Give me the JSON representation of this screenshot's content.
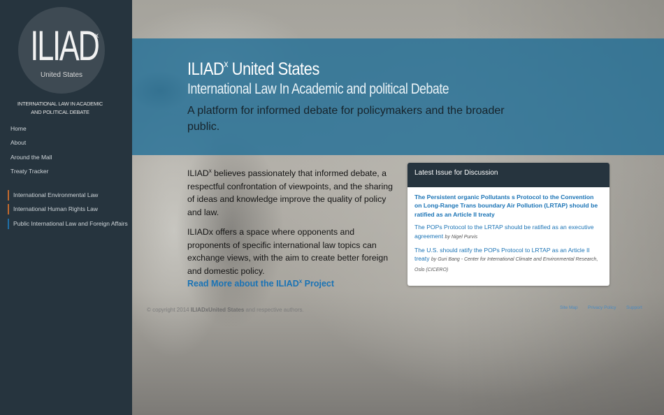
{
  "sidebar": {
    "logo": {
      "main": "ILIAD",
      "sup": "x",
      "sub": "United States"
    },
    "tagline": "INTERNATIONAL LAW IN ACADEMIC AND POLITICAL DEBATE",
    "nav": [
      "Home",
      "About",
      "Around the Mall",
      "Treaty Tracker"
    ],
    "topics": [
      {
        "label": "International Environmental Law",
        "color": "#c26a2d"
      },
      {
        "label": "International Human Rights Law",
        "color": "#c26a2d"
      },
      {
        "label": "Public International Law and Foreign Affairs",
        "color": "#1f6fa6"
      }
    ]
  },
  "header": {
    "title_main": "ILIAD",
    "title_sup": "x",
    "title_rest": " United States",
    "subtitle": "International Law In Academic and political Debate",
    "description": "A platform for informed debate for policymakers and the broader public."
  },
  "content": {
    "para1_prefix": "ILIAD",
    "para1_sup": "x",
    "para1_rest": " believes passionately that informed debate, a respectful confrontation of viewpoints, and the sharing of ideas and knowledge improve the quality of policy and law.",
    "para2": "ILIADx offers a space where opponents and proponents of specific international law topics can exchange views, with the aim to create better foreign and domestic policy.",
    "read_more_prefix": "Read More about the ILIAD",
    "read_more_sup": "x",
    "read_more_suffix": " Project"
  },
  "panel": {
    "heading": "Latest Issue for Discussion",
    "issues": [
      {
        "title": "The Persistent organic Pollutants s Protocol to the Convention on Long-Range Trans boundary Air Pollution (LRTAP) should be ratified as an Article II treaty",
        "author": "",
        "bold": true
      },
      {
        "title": "The POPs Protocol to the LRTAP should be ratified as an executive agreement",
        "author": "by Nigel Purvis",
        "bold": false
      },
      {
        "title": "The U.S. should ratify the POPs Protocol to LRTAP as an Article II treaty",
        "author": "by Guri Bang - Center for International Climate and Environmental Research, Oslo (CICERO)",
        "bold": false
      }
    ]
  },
  "footer": {
    "copy_prefix": "© copyright 2014",
    "copy_brand": "ILIADxUnited States",
    "copy_suffix": "and respective authors.",
    "links": [
      "Site Map",
      "Privacy Policy",
      "Support"
    ]
  },
  "colors": {
    "sidebar": "#26343e",
    "banner": "#206e96",
    "link": "#1a73b5",
    "accent_orange": "#c26a2d",
    "accent_blue": "#1f6fa6"
  }
}
